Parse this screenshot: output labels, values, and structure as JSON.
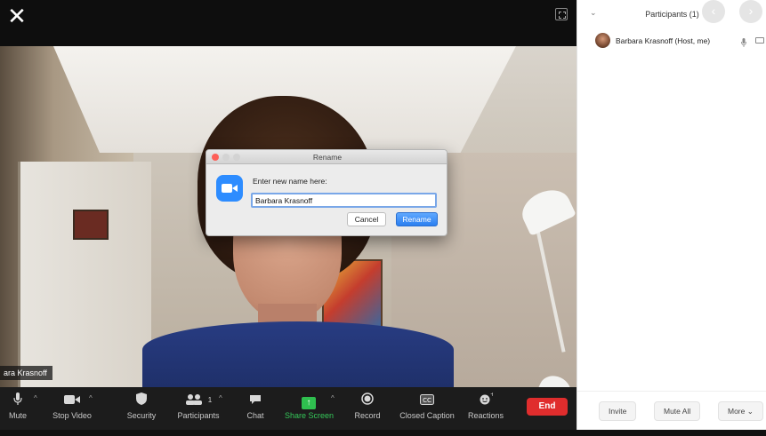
{
  "video": {
    "participant_label": "ara Krasnoff"
  },
  "toolbar": {
    "mute": "Mute",
    "stop_video": "Stop Video",
    "security": "Security",
    "participants": "Participants",
    "participants_count": "1",
    "chat": "Chat",
    "share_screen": "Share Screen",
    "record": "Record",
    "closed_caption": "Closed Caption",
    "reactions": "Reactions",
    "end": "End"
  },
  "panel": {
    "title": "Participants (1)",
    "participants": [
      {
        "name": "Barbara Krasnoff (Host, me)"
      }
    ],
    "buttons": {
      "invite": "Invite",
      "mute_all": "Mute All",
      "more": "More ⌄"
    }
  },
  "dialog": {
    "title": "Rename",
    "prompt": "Enter new name here:",
    "input_value": "Barbara Krasnoff",
    "cancel": "Cancel",
    "rename": "Rename"
  },
  "colors": {
    "end_red": "#e02d2d",
    "share_green": "#2fbf4f",
    "zoom_blue": "#2d8cff",
    "rename_blue": "#2b7ff0"
  }
}
